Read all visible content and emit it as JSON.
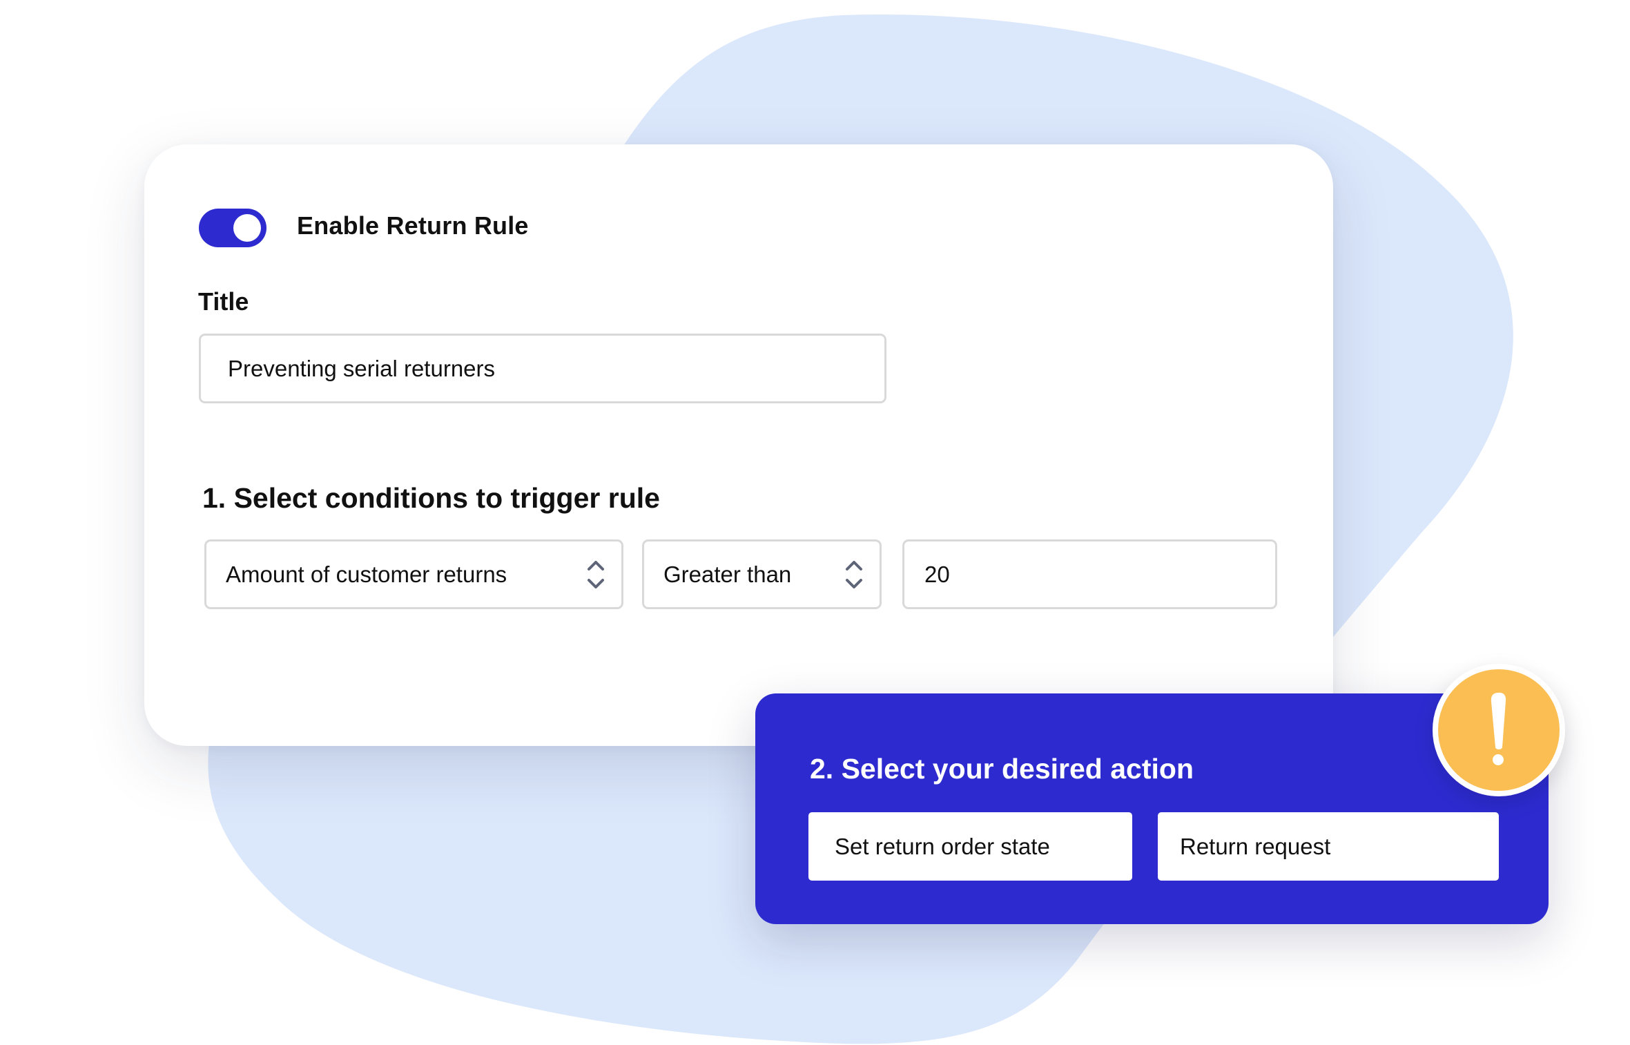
{
  "colors": {
    "accent": "#2d2bcf",
    "background_blob": "#dbe7fb",
    "alert": "#fbbe52",
    "field_border": "#d9d9d9"
  },
  "rule": {
    "toggle_on": true,
    "toggle_label": "Enable Return Rule",
    "title_label": "Title",
    "title_value": "Preventing serial returners"
  },
  "conditions": {
    "heading": "1. Select conditions to trigger rule",
    "condition_selected": "Amount of customer returns",
    "operator_selected": "Greater than",
    "value": "20"
  },
  "action": {
    "heading": "2. Select your desired action",
    "action_type": "Set return order state",
    "action_value": "Return request"
  },
  "icons": {
    "alert": "exclamation-icon",
    "select_arrows": "chevron-up-down-icon"
  }
}
